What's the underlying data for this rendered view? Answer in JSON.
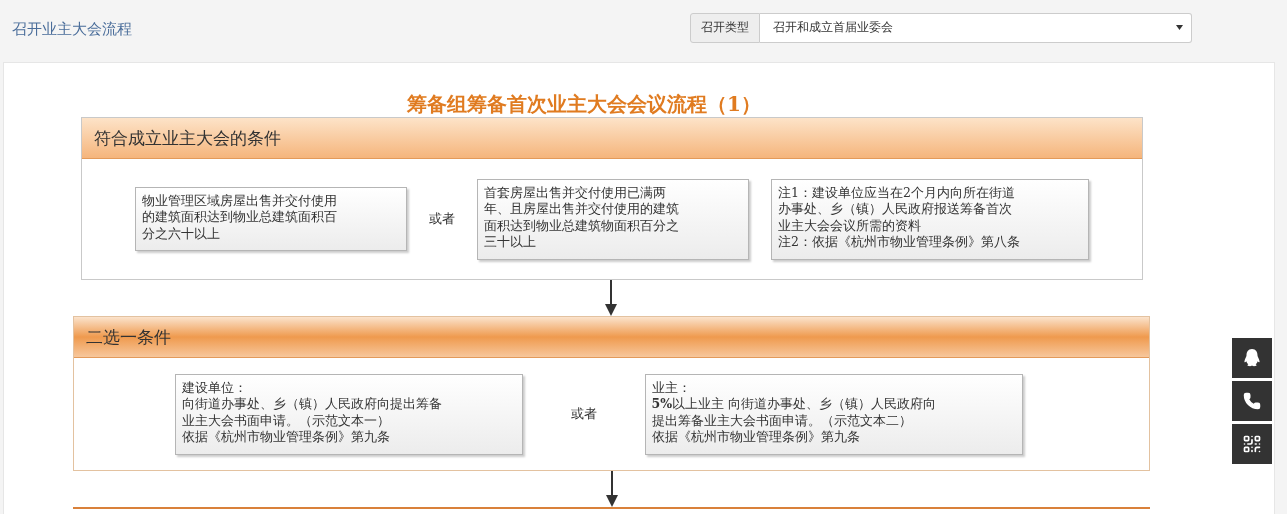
{
  "page_title": "召开业主大会流程",
  "filter": {
    "label": "召开类型",
    "value": "召开和成立首届业委会"
  },
  "flowchart": {
    "title": "筹备组筹备首次业主大会会议流程（1）",
    "sections": [
      {
        "heading": "符合成立业主大会的条件",
        "items": [
          {
            "kind": "box",
            "lines": [
              "物业管理区域房屋出售并交付使用",
              "的建筑面积达到物业总建筑面积百",
              "分之六十以上"
            ]
          },
          {
            "kind": "or",
            "text": "或者"
          },
          {
            "kind": "box",
            "lines": [
              "首套房屋出售并交付使用已满两",
              "年、且房屋出售并交付使用的建筑",
              "面积达到物业总建筑物面积百分之",
              "三十以上"
            ]
          },
          {
            "kind": "note",
            "lines": [
              "注1：建设单位应当在2个月内向所在街道",
              "办事处、乡（镇）人民政府报送筹备首次",
              "业主大会会议所需的资料",
              "注2：依据《杭州市物业管理条例》第八条"
            ]
          }
        ]
      },
      {
        "heading": "二选一条件",
        "items": [
          {
            "kind": "box",
            "lines": [
              "建设单位：",
              "向街道办事处、乡（镇）人民政府向提出筹备",
              "业主大会书面申请。（示范文本一）",
              "依据《杭州市物业管理条例》第九条"
            ]
          },
          {
            "kind": "or",
            "text": "或者"
          },
          {
            "kind": "box",
            "lines": [
              "业主：",
              "**5%**以上业主 向街道办事处、乡（镇）人民政府向",
              "提出筹备业主大会书面申请。（示范文本二）",
              " 依据《杭州市物业管理条例》第九条"
            ]
          }
        ]
      }
    ]
  }
}
